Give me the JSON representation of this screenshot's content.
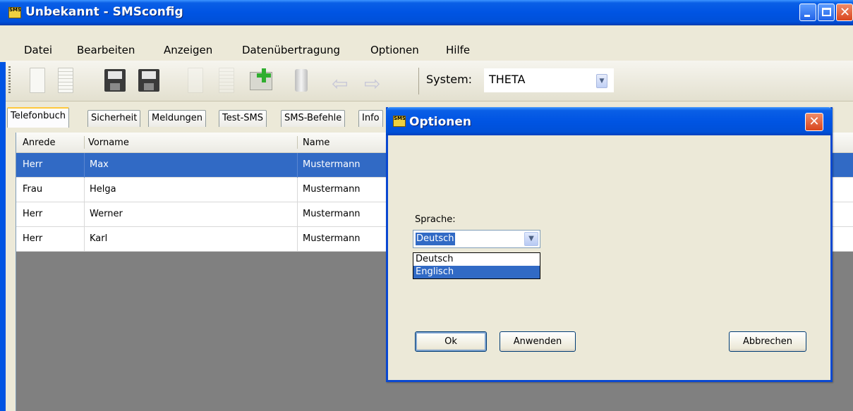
{
  "window": {
    "title": "Unbekannt - SMSconfig",
    "app_icon_text": "SMS config"
  },
  "menu": [
    {
      "label": "Datei"
    },
    {
      "label": "Bearbeiten"
    },
    {
      "label": "Anzeigen"
    },
    {
      "label": "Datenübertragung"
    },
    {
      "label": "Optionen"
    },
    {
      "label": "Hilfe"
    }
  ],
  "toolbar": {
    "system_label": "System:",
    "system_value": "THETA",
    "icons": [
      "new-document-icon",
      "open-document-icon",
      "save-disk-icon",
      "save-as-disk-icon",
      "copy-icon",
      "paste-icon",
      "add-entry-icon",
      "delete-bin-icon",
      "back-arrow-icon",
      "forward-arrow-icon"
    ]
  },
  "tabs": [
    "Telefonbuch",
    "Sicherheit",
    "Meldungen",
    "Test-SMS",
    "SMS-Befehle",
    "Info"
  ],
  "table": {
    "columns": [
      "Anrede",
      "Vorname",
      "Name"
    ],
    "rows": [
      {
        "anrede": "Herr",
        "vorname": "Max",
        "name": "Mustermann"
      },
      {
        "anrede": "Frau",
        "vorname": "Helga",
        "name": "Mustermann"
      },
      {
        "anrede": "Herr",
        "vorname": "Werner",
        "name": "Mustermann"
      },
      {
        "anrede": "Herr",
        "vorname": "Karl",
        "name": "Mustermann"
      }
    ]
  },
  "dialog": {
    "title": "Optionen",
    "language_label": "Sprache:",
    "language_value": "Deutsch",
    "language_options": [
      "Deutsch",
      "Englisch"
    ],
    "buttons": {
      "ok": "Ok",
      "apply": "Anwenden",
      "cancel": "Abbrechen"
    }
  },
  "colors": {
    "titlebar": "#0054e3",
    "selection": "#316ac5",
    "window_bg": "#ece9d8"
  }
}
